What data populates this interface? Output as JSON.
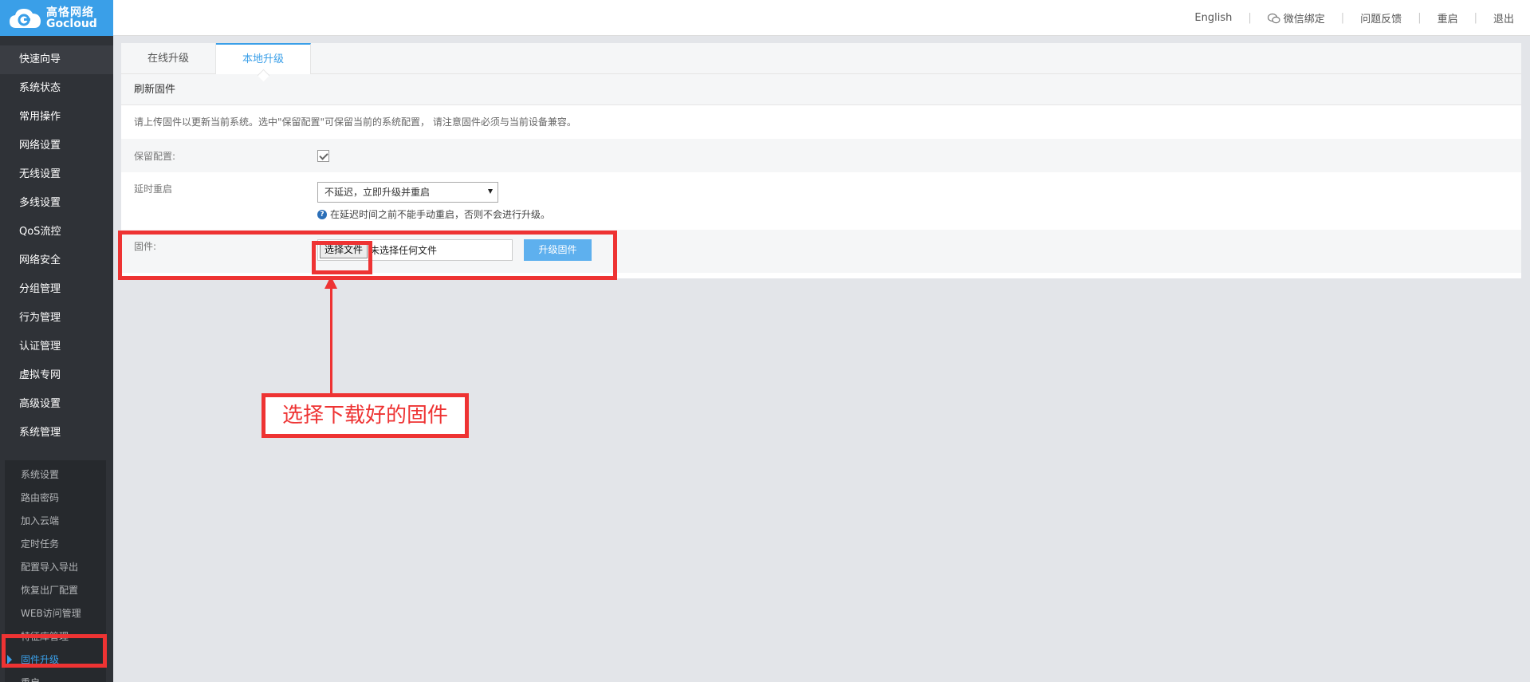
{
  "brand": {
    "name_cn": "高恪网络",
    "name_en": "Gocloud"
  },
  "topnav": {
    "english": "English",
    "wechat": "微信绑定",
    "feedback": "问题反馈",
    "reboot": "重启",
    "logout": "退出"
  },
  "sidebar": {
    "items": [
      "快速向导",
      "系统状态",
      "常用操作",
      "网络设置",
      "无线设置",
      "多线设置",
      "QoS流控",
      "网络安全",
      "分组管理",
      "行为管理",
      "认证管理",
      "虚拟专网",
      "高级设置",
      "系统管理"
    ],
    "submenu": [
      "系统设置",
      "路由密码",
      "加入云端",
      "定时任务",
      "配置导入导出",
      "恢复出厂配置",
      "WEB访问管理",
      "特征库管理",
      "固件升级",
      "重启"
    ],
    "active_sub": "固件升级"
  },
  "tabs": [
    "在线升级",
    "本地升级"
  ],
  "active_tab": "本地升级",
  "section": {
    "title": "刷新固件",
    "description": "请上传固件以更新当前系统。选中\"保留配置\"可保留当前的系统配置， 请注意固件必须与当前设备兼容。",
    "keep_config_label": "保留配置:",
    "keep_config_checked": true,
    "delay_label": "延时重启",
    "delay_value": "不延迟，立即升级并重启",
    "delay_hint": "在延迟时间之前不能手动重启，否则不会进行升级。",
    "firmware_label": "固件:",
    "choose_file": "选择文件",
    "no_file": "未选择任何文件",
    "upgrade_button": "升级固件"
  },
  "annotation": {
    "callout_text": "选择下载好的固件"
  },
  "colors": {
    "accent": "#3a9fe8",
    "sidebar_bg": "#2f3237",
    "annotation_red": "#e33"
  }
}
